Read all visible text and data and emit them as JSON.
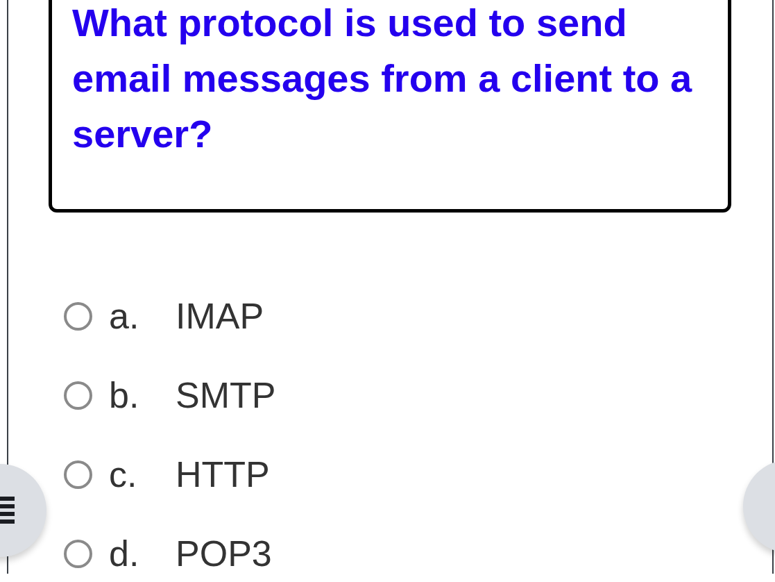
{
  "question": "What protocol is used to send email messages from a client to a server?",
  "options": [
    {
      "letter": "a.",
      "text": "IMAP",
      "selected": false
    },
    {
      "letter": "b.",
      "text": "SMTP",
      "selected": false
    },
    {
      "letter": "c.",
      "text": "HTTP",
      "selected": false
    },
    {
      "letter": "d.",
      "text": "POP3",
      "selected": false
    }
  ]
}
